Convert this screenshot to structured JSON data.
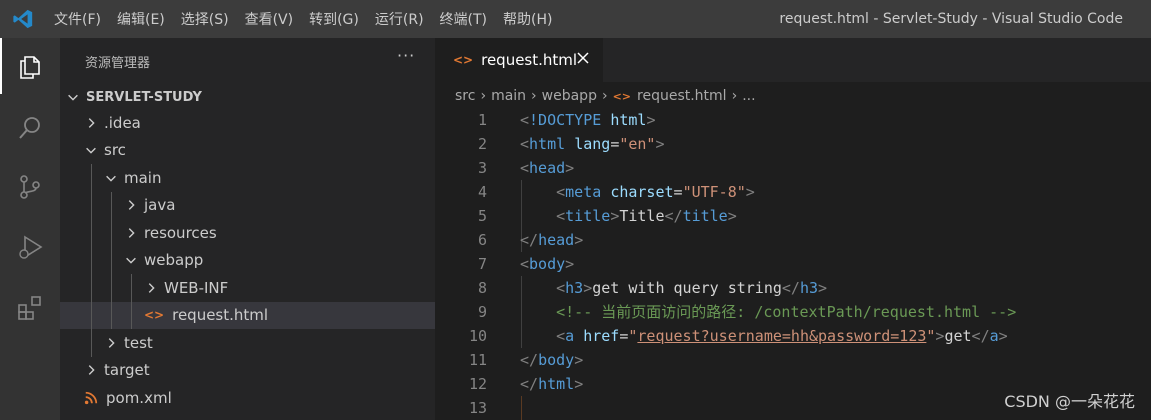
{
  "titlebar": {
    "menu": [
      "文件(F)",
      "编辑(E)",
      "选择(S)",
      "查看(V)",
      "转到(G)",
      "运行(R)",
      "终端(T)",
      "帮助(H)"
    ],
    "window_title": "request.html - Servlet-Study - Visual Studio Code"
  },
  "activity_bar": [
    "explorer-icon",
    "search-icon",
    "source-control-icon",
    "run-debug-icon",
    "extensions-icon"
  ],
  "sidebar": {
    "title": "资源管理器",
    "more": "···",
    "section": "SERVLET-STUDY",
    "tree": [
      {
        "label": ".idea",
        "depth": 1,
        "kind": "folder",
        "expanded": false
      },
      {
        "label": "src",
        "depth": 1,
        "kind": "folder",
        "expanded": true
      },
      {
        "label": "main",
        "depth": 2,
        "kind": "folder",
        "expanded": true
      },
      {
        "label": "java",
        "depth": 3,
        "kind": "folder",
        "expanded": false
      },
      {
        "label": "resources",
        "depth": 3,
        "kind": "folder",
        "expanded": false
      },
      {
        "label": "webapp",
        "depth": 3,
        "kind": "folder",
        "expanded": true
      },
      {
        "label": "WEB-INF",
        "depth": 4,
        "kind": "folder",
        "expanded": false
      },
      {
        "label": "request.html",
        "depth": 4,
        "kind": "html",
        "selected": true
      },
      {
        "label": "test",
        "depth": 2,
        "kind": "folder",
        "expanded": false
      },
      {
        "label": "target",
        "depth": 1,
        "kind": "folder",
        "expanded": false
      },
      {
        "label": "pom.xml",
        "depth": 1,
        "kind": "xml"
      }
    ]
  },
  "tab": {
    "icon": "<>",
    "label": "request.html"
  },
  "breadcrumb": [
    "src",
    "main",
    "webapp",
    "request.html",
    "..."
  ],
  "editor": {
    "line_numbers": [
      "1",
      "2",
      "3",
      "4",
      "5",
      "6",
      "7",
      "8",
      "9",
      "10",
      "11",
      "12",
      "13"
    ]
  },
  "watermark": "CSDN @一朵花花",
  "colors": {
    "accent": "#007acc",
    "html_icon": "#e37933",
    "tag": "#569cd6",
    "string": "#ce9178",
    "comment": "#6a9955"
  }
}
